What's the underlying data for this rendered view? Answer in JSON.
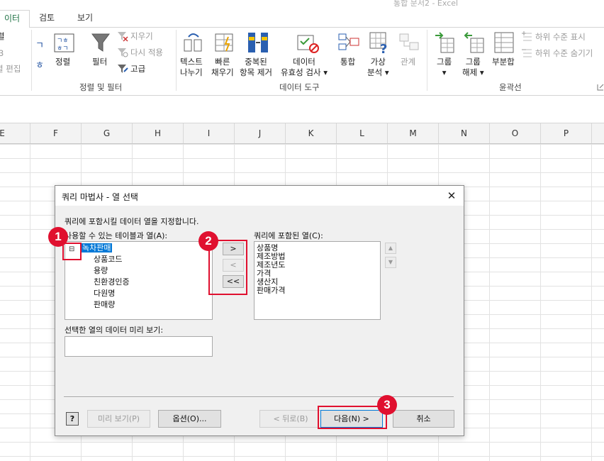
{
  "window": {
    "title": "통합 문서2 - Excel"
  },
  "tabs": [
    {
      "label": "이터",
      "active": true
    },
    {
      "label": "검토",
      "active": false
    },
    {
      "label": "보기",
      "active": false
    }
  ],
  "ribbon": {
    "sort_filter": {
      "partial_labels": [
        "렬",
        "3",
        "렬 편집"
      ],
      "sort_label": "정렬",
      "filter_label": "필터",
      "clear_label": "지우기",
      "reapply_label": "다시 적용",
      "advanced_label": "고급",
      "group_label": "정렬 및 필터"
    },
    "data_tools": {
      "text_to_columns": [
        "텍스트",
        "나누기"
      ],
      "flash_fill": [
        "빠른",
        "채우기"
      ],
      "remove_duplicates": [
        "중복된",
        "항목 제거"
      ],
      "data_validation": [
        "데이터",
        "유효성 검사 ▾"
      ],
      "consolidate": "통합",
      "what_if": [
        "가상",
        "분석 ▾"
      ],
      "relationships": "관계",
      "group_label": "데이터 도구"
    },
    "outline": {
      "group": [
        "그룹",
        "▾"
      ],
      "ungroup": [
        "그룹",
        "해제 ▾"
      ],
      "subtotal": "부분합",
      "show_detail": "하위 수준 표시",
      "hide_detail": "하위 수준 숨기기",
      "group_label": "윤곽선"
    }
  },
  "columns": [
    "E",
    "F",
    "G",
    "H",
    "I",
    "J",
    "K",
    "L",
    "M",
    "N",
    "O",
    "P"
  ],
  "dialog": {
    "title": "쿼리 마법사 - 열 선택",
    "close": "✕",
    "instruction": "쿼리에 포함시킬 데이터 열을 지정합니다.",
    "available_label": "사용할 수 있는 테이블과 열(A):",
    "included_label": "쿼리에 포함된 열(C):",
    "preview_label": "선택한 열의 데이터 미리 보기:",
    "tree_expander": "⊟",
    "table_name": "녹차판매",
    "available_columns": [
      "상품코드",
      "용량",
      "친환경인증",
      "다원명",
      "판매량"
    ],
    "included_columns": [
      "상품명",
      "제조방법",
      "제조년도",
      "가격",
      "생산지",
      "판매가격"
    ],
    "move_buttons": {
      "add": ">",
      "remove": "<",
      "remove_all": "<<"
    },
    "scroll_up": "▲",
    "scroll_down": "▼",
    "help_button": "?",
    "preview_button": "미리 보기(P)",
    "options_button": "옵션(O)...",
    "back_button": "< 뒤로(B)",
    "next_button": "다음(N) >",
    "cancel_button": "취소"
  },
  "annotations": {
    "badge1": "1",
    "badge2": "2",
    "badge3": "3"
  },
  "colors": {
    "accent": "#217346",
    "annotation_red": "#e0102f",
    "selection": "#0078d7"
  }
}
